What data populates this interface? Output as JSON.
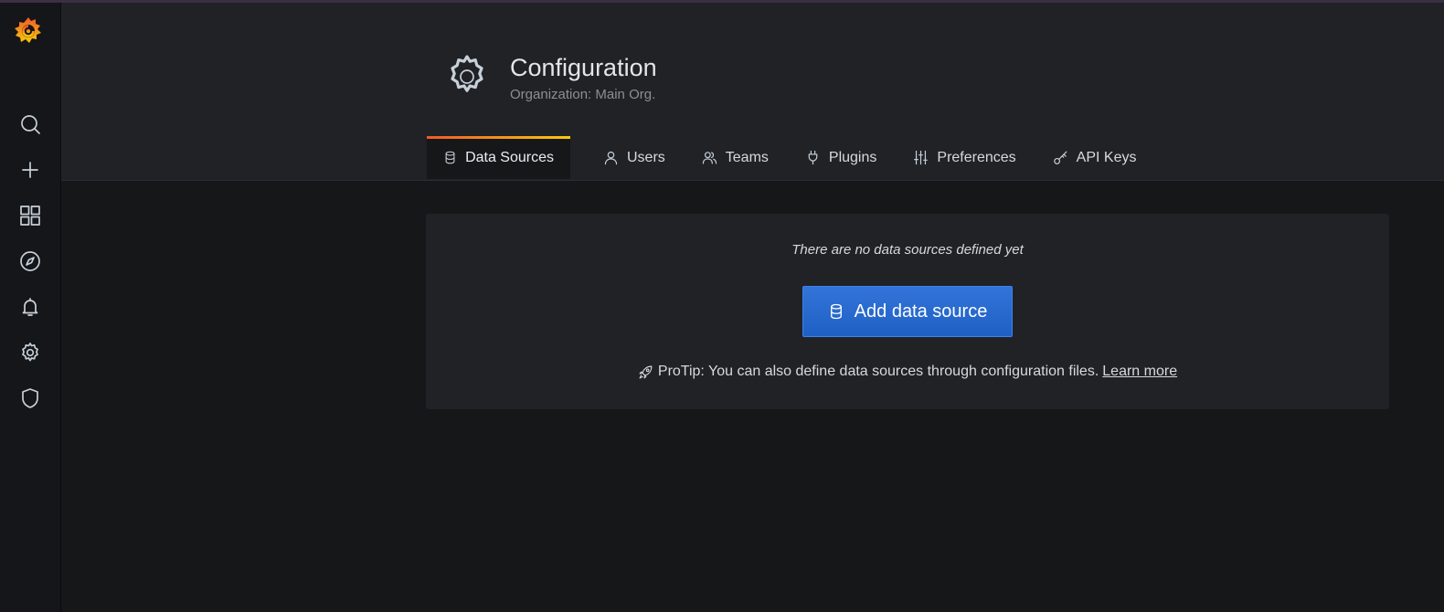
{
  "sidebar": {
    "items": [
      {
        "icon": "search-icon"
      },
      {
        "icon": "plus-icon"
      },
      {
        "icon": "dashboards-grid-icon"
      },
      {
        "icon": "compass-icon"
      },
      {
        "icon": "bell-icon"
      },
      {
        "icon": "gear-icon"
      },
      {
        "icon": "shield-icon"
      }
    ]
  },
  "header": {
    "title": "Configuration",
    "subtitle": "Organization: Main Org."
  },
  "tabs": [
    {
      "label": "Data Sources",
      "icon": "database-icon",
      "active": true
    },
    {
      "label": "Users",
      "icon": "user-icon",
      "active": false
    },
    {
      "label": "Teams",
      "icon": "users-icon",
      "active": false
    },
    {
      "label": "Plugins",
      "icon": "plug-icon",
      "active": false
    },
    {
      "label": "Preferences",
      "icon": "sliders-icon",
      "active": false
    },
    {
      "label": "API Keys",
      "icon": "key-icon",
      "active": false
    }
  ],
  "empty_state": {
    "message": "There are no data sources defined yet",
    "button_label": "Add data source",
    "protip": "ProTip: You can also define data sources through configuration files.",
    "learn_more": "Learn more"
  },
  "colors": {
    "accent_blue": "#3274d9",
    "tab_gradient_start": "#f05a28",
    "tab_gradient_end": "#fbca0a",
    "background": "#161719",
    "header_background": "#202226"
  }
}
